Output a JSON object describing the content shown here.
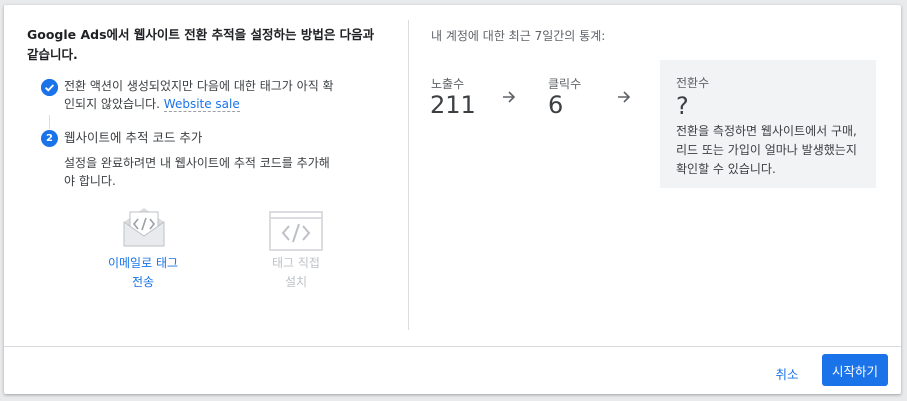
{
  "heading_line1": "Google Ads에서 웹사이트 전환 추적을 설정하는 방법은 다음과",
  "heading_line2": "같습니다.",
  "step1": {
    "line1": "전환 액션이 생성되었지만 다음에 대한 태그가 아직 확",
    "line2_prefix": "인되지 않았습니다.",
    "link": "Website sale",
    "icon": "check-icon"
  },
  "step2": {
    "number": "2",
    "title": "웹사이트에 추적 코드 추가",
    "desc_line1": "설정을 완료하려면 내 웹사이트에 추적 코드를 추가해",
    "desc_line2": "야 합니다."
  },
  "options": {
    "email": {
      "line1": "이메일로 태그",
      "line2": "전송",
      "icon": "email-code-icon"
    },
    "install": {
      "line1": "태그 직접",
      "line2": "설치",
      "icon": "browser-code-icon"
    }
  },
  "stats": {
    "title": "내 계정에 대한 최근 7일간의 통계:",
    "impressions_label": "노출수",
    "impressions_value": "211",
    "clicks_label": "클릭수",
    "clicks_value": "6",
    "conversions_label": "전환수",
    "conversions_value": "?",
    "conversions_desc": "전환을 측정하면 웹사이트에서 구매, 리드 또는 가입이 얼마나 발생했는지 확인할 수 있습니다."
  },
  "buttons": {
    "cancel": "취소",
    "start": "시작하기"
  },
  "colors": {
    "primary": "#1a73e8",
    "disabled": "#bdc1c6"
  }
}
